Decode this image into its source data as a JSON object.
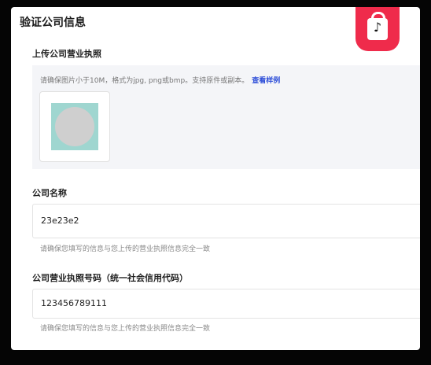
{
  "page": {
    "title": "验证公司信息"
  },
  "license_upload": {
    "label": "上传公司营业执照",
    "hint": "请确保图片小于10M，格式为jpg, png或bmp。支持原件或副本。",
    "sample_link": "查看样例"
  },
  "company_name": {
    "label": "公司名称",
    "value": "23e23e2",
    "helper": "请确保您填写的信息与您上传的营业执照信息完全一致"
  },
  "license_number": {
    "label": "公司营业执照号码（统一社会信用代码）",
    "value": "123456789111",
    "helper": "请确保您填写的信息与您上传的营业执照信息完全一致"
  },
  "icons": {
    "app_badge": "tiktok-shop-icon",
    "uploaded_image": "license-thumbnail"
  },
  "colors": {
    "badge": "#ef2b4b",
    "link": "#2d4ed8",
    "panel": "#f4f5f8"
  }
}
